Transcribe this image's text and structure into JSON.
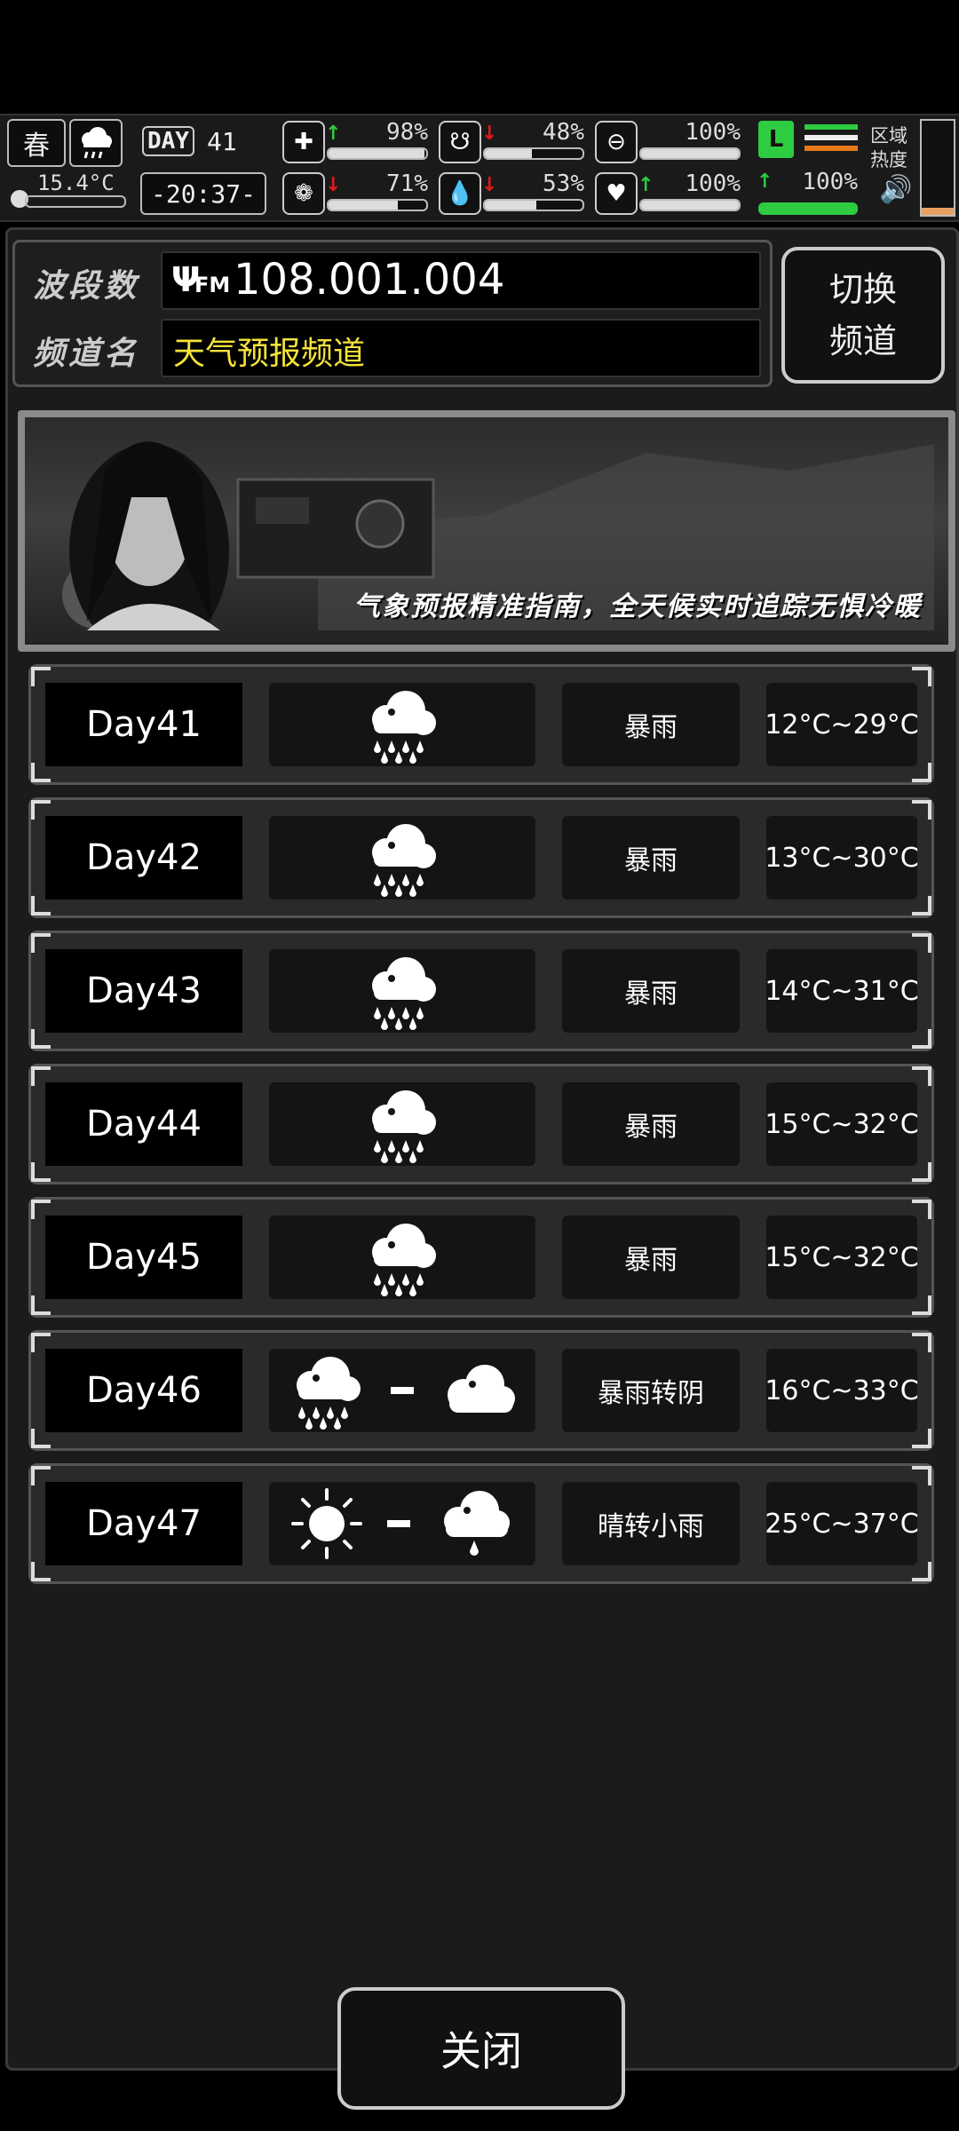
{
  "hud": {
    "season": "春",
    "temperature": "15.4°C",
    "day_label": "DAY",
    "day_number": "41",
    "time": "-20:37-",
    "region_heat": "区域\n热度",
    "stats": [
      {
        "icon": "medkit-icon",
        "trend": "up",
        "value": "98%",
        "fraction": 0.98
      },
      {
        "icon": "stomach-icon",
        "trend": "down",
        "value": "48%",
        "fraction": 0.48
      },
      {
        "icon": "pill-icon",
        "trend": "none",
        "value": "100%",
        "fraction": 1.0
      },
      {
        "icon": "brain-icon",
        "trend": "down",
        "value": "71%",
        "fraction": 0.71
      },
      {
        "icon": "water-drop-icon",
        "trend": "down",
        "value": "53%",
        "fraction": 0.53
      },
      {
        "icon": "heart-icon",
        "trend": "up",
        "value": "100%",
        "fraction": 1.0
      }
    ],
    "stamina": {
      "trend": "up",
      "value": "100%",
      "fraction": 1.0
    }
  },
  "channel": {
    "band_label": "波段数",
    "freq_prefix": "FM",
    "frequency": "108.001.004",
    "name_label": "频道名",
    "channel_name": "天气预报频道"
  },
  "switch_button": {
    "line1": "切换",
    "line2": "频道"
  },
  "banner": {
    "slogan": "气象预报精准指南，全天候实时追踪无惧冷暖"
  },
  "forecast": [
    {
      "day": "Day41",
      "icons": [
        "heavy-rain"
      ],
      "weather": "暴雨",
      "temp": "12°C~29°C"
    },
    {
      "day": "Day42",
      "icons": [
        "heavy-rain"
      ],
      "weather": "暴雨",
      "temp": "13°C~30°C"
    },
    {
      "day": "Day43",
      "icons": [
        "heavy-rain"
      ],
      "weather": "暴雨",
      "temp": "14°C~31°C"
    },
    {
      "day": "Day44",
      "icons": [
        "heavy-rain"
      ],
      "weather": "暴雨",
      "temp": "15°C~32°C"
    },
    {
      "day": "Day45",
      "icons": [
        "heavy-rain"
      ],
      "weather": "暴雨",
      "temp": "15°C~32°C"
    },
    {
      "day": "Day46",
      "icons": [
        "heavy-rain",
        "cloudy"
      ],
      "weather": "暴雨转阴",
      "temp": "16°C~33°C"
    },
    {
      "day": "Day47",
      "icons": [
        "sunny",
        "light-rain"
      ],
      "weather": "晴转小雨",
      "temp": "25°C~37°C"
    }
  ],
  "close_button": "关闭"
}
